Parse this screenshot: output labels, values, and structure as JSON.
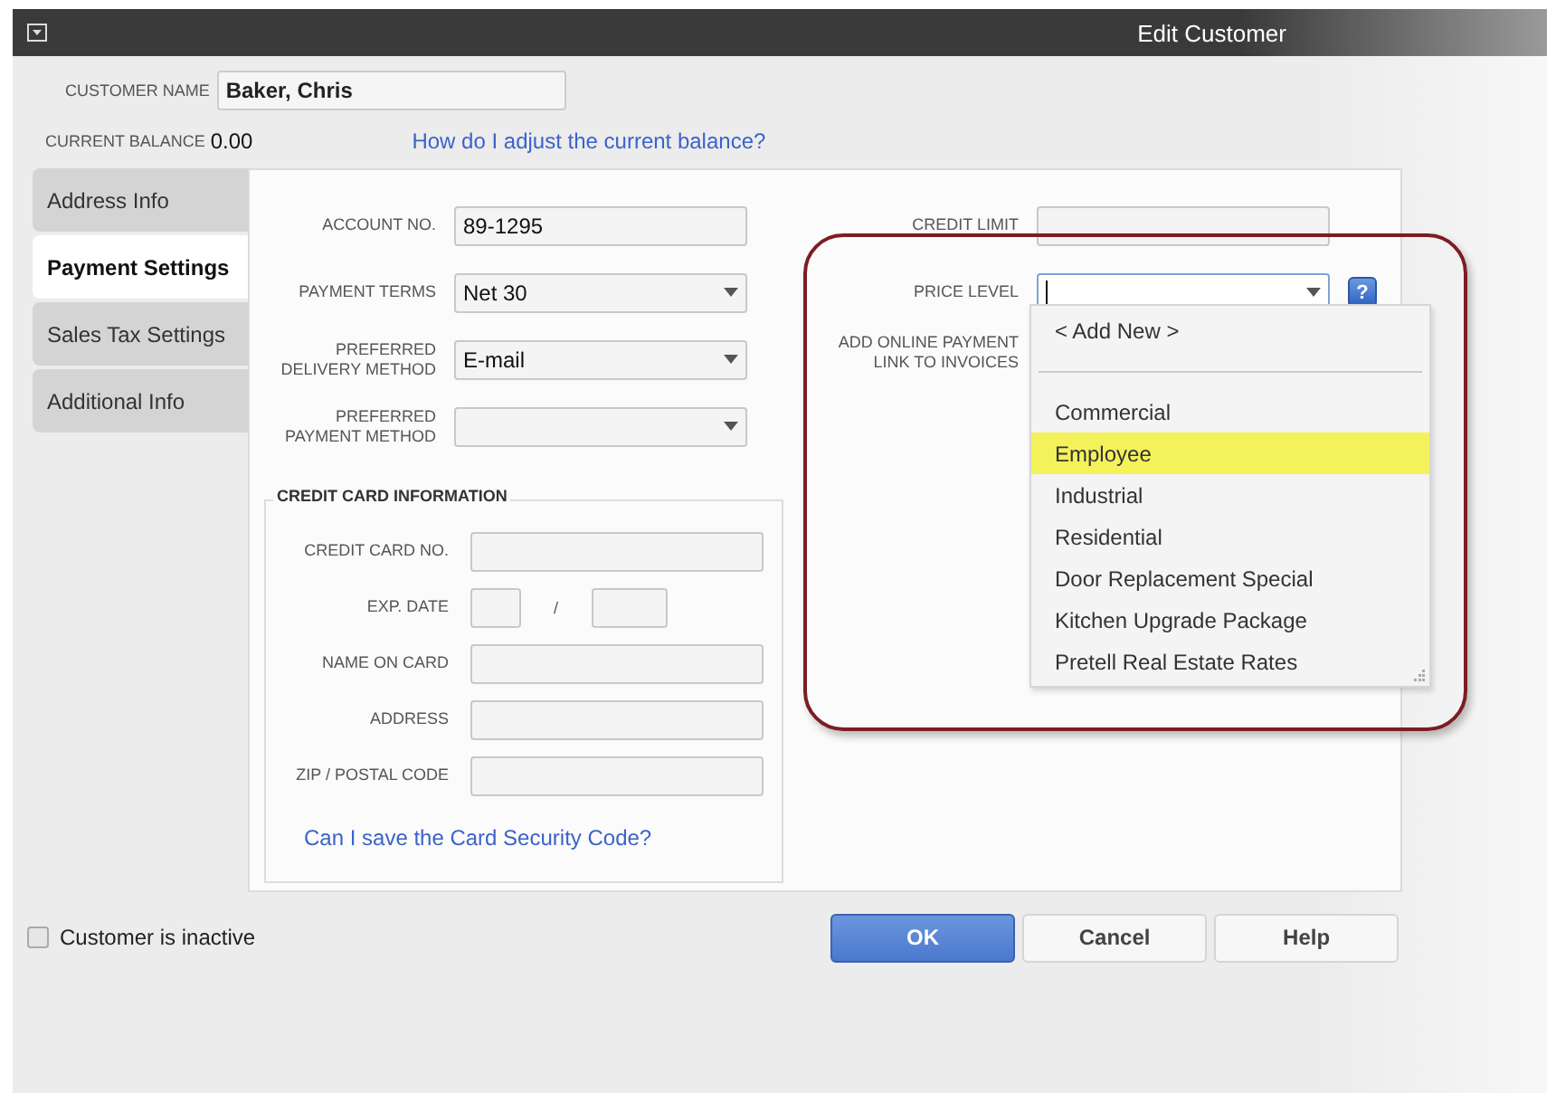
{
  "window": {
    "title": "Edit Customer"
  },
  "customer_name": {
    "label": "CUSTOMER NAME",
    "value": "Baker, Chris"
  },
  "current_balance": {
    "label": "CURRENT BALANCE",
    "value": "0.00"
  },
  "balance_help_link": "How do I adjust the current balance?",
  "tabs": [
    {
      "label": "Address Info",
      "selected": false
    },
    {
      "label": "Payment Settings",
      "selected": true
    },
    {
      "label": "Sales Tax Settings",
      "selected": false
    },
    {
      "label": "Additional Info",
      "selected": false
    }
  ],
  "payment_fields": [
    {
      "label": "ACCOUNT NO.",
      "kind": "text",
      "value": "89-1295"
    },
    {
      "label": "PAYMENT TERMS",
      "kind": "select",
      "value": "Net 30"
    },
    {
      "label": "PREFERRED DELIVERY METHOD",
      "kind": "select",
      "value": "E-mail"
    },
    {
      "label": "PREFERRED PAYMENT METHOD",
      "kind": "select"
    }
  ],
  "credit_card": {
    "title": "CREDIT CARD INFORMATION",
    "fields": [
      {
        "label": "CREDIT CARD NO.",
        "kind": "text"
      },
      {
        "label": "EXP. DATE",
        "kind": "date",
        "separator": "/"
      },
      {
        "label": "NAME ON CARD",
        "kind": "text"
      },
      {
        "label": "ADDRESS",
        "kind": "text"
      },
      {
        "label": "ZIP / POSTAL CODE",
        "kind": "text"
      }
    ],
    "help_link": "Can I save the Card Security Code?"
  },
  "right_fields": [
    {
      "label": "CREDIT LIMIT",
      "kind": "text"
    },
    {
      "label": "PRICE LEVEL",
      "kind": "select",
      "focused": true,
      "help": "?"
    },
    {
      "label": "ADD ONLINE PAYMENT LINK TO INVOICES",
      "kind": "none"
    }
  ],
  "price_level_list": [
    {
      "kind": "action",
      "label": "< Add New >",
      "selected": false
    },
    {
      "kind": "separator"
    },
    {
      "kind": "option",
      "label": "Commercial",
      "selected": false
    },
    {
      "kind": "option",
      "label": "Employee",
      "selected": true
    },
    {
      "kind": "option",
      "label": "Industrial",
      "selected": false
    },
    {
      "kind": "option",
      "label": "Residential",
      "selected": false
    },
    {
      "kind": "option",
      "label": "Door Replacement Special",
      "selected": false
    },
    {
      "kind": "option",
      "label": "Kitchen Upgrade Package",
      "selected": false
    },
    {
      "kind": "option",
      "label": "Pretell Real Estate Rates",
      "selected": false
    }
  ],
  "inactive": {
    "label": "Customer is inactive",
    "checked": false
  },
  "buttons": [
    {
      "label": "OK",
      "kind": "primary"
    },
    {
      "label": "Cancel",
      "kind": "normal"
    },
    {
      "label": "Help",
      "kind": "normal"
    }
  ]
}
